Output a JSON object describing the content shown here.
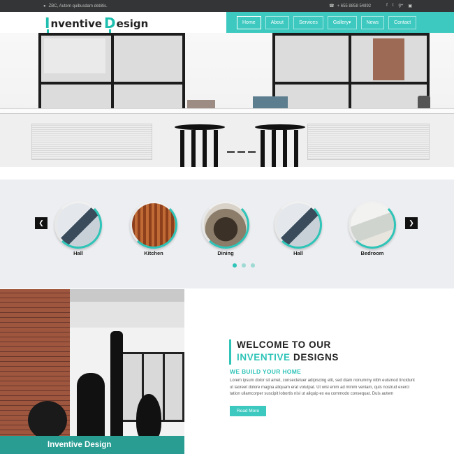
{
  "topbar": {
    "address": "ZBC, Autem quibusdam debitis.",
    "phone": "+ 655 8858 54892",
    "social_icons": [
      "facebook-icon",
      "twitter-icon",
      "google-plus-icon",
      "instagram-icon"
    ]
  },
  "header": {
    "logo_cap1": "I",
    "logo_rest1": "nventive ",
    "logo_cap2": "D",
    "logo_rest2": "esign"
  },
  "nav": {
    "items": [
      "Home",
      "About",
      "Services",
      "Gallery",
      "News",
      "Contact"
    ],
    "active": "Home"
  },
  "carousel": {
    "rooms": [
      "Hall",
      "Kitchen",
      "Dining",
      "Hall",
      "Bedroom"
    ],
    "prev_icon": "chevron-left-icon",
    "next_icon": "chevron-right-icon"
  },
  "welcome": {
    "title_line1": "WELCOME TO OUR",
    "title_highlight": "INVENTIVE",
    "title_rest": " DESIGNS",
    "subtitle": "WE BUILD YOUR HOME",
    "body": "Lorem ipsum dolor sit amet, consectetuer adipiscing elit, sed diam nonummy nibh euismod tincidunt ut laoreet dolore magna aliquam erat volutpat. Ut wisi enim ad minim veniam, quis nostrud exerci tation ullamcorper suscipit lobortis nisl ut aliquip ex ea commodo consequat. Duis autem",
    "button": "Read More",
    "photo_caption": "Inventive Design"
  },
  "colors": {
    "accent": "#3dc9c0",
    "topbar": "#343536",
    "caption_bg": "#2a9d93"
  }
}
